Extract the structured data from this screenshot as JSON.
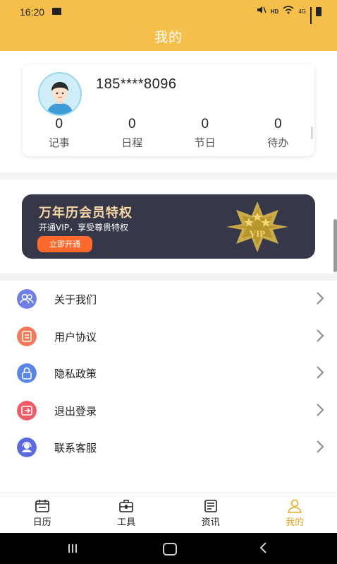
{
  "status_bar": {
    "time": "16:20",
    "network": "4G"
  },
  "header": {
    "title": "我的"
  },
  "profile": {
    "phone": "185****8096",
    "stats": [
      {
        "value": "0",
        "label": "记事"
      },
      {
        "value": "0",
        "label": "日程"
      },
      {
        "value": "0",
        "label": "节日"
      },
      {
        "value": "0",
        "label": "待办"
      }
    ]
  },
  "vip": {
    "title": "万年历会员特权",
    "subtitle": "开通VIP，享受尊贵特权",
    "button": "立即开通",
    "badge_text": "VIP"
  },
  "menu": {
    "items": [
      {
        "label": "关于我们",
        "icon": "users-icon",
        "color": "#6f7fe6"
      },
      {
        "label": "用户协议",
        "icon": "document-icon",
        "color": "#f27a5a"
      },
      {
        "label": "隐私政策",
        "icon": "lock-icon",
        "color": "#5b86e6"
      },
      {
        "label": "退出登录",
        "icon": "logout-icon",
        "color": "#ef5b66"
      },
      {
        "label": "联系客服",
        "icon": "headset-icon",
        "color": "#5b6ae0"
      }
    ]
  },
  "tabs": [
    {
      "label": "日历",
      "icon": "calendar-icon",
      "active": false
    },
    {
      "label": "工具",
      "icon": "toolbox-icon",
      "active": false
    },
    {
      "label": "资讯",
      "icon": "news-icon",
      "active": false
    },
    {
      "label": "我的",
      "icon": "user-icon",
      "active": true
    }
  ],
  "colors": {
    "brand": "#f6bf4a",
    "vip_bg": "#37374a",
    "vip_button": "#ff6a2c",
    "active_tab": "#e9a92a"
  }
}
